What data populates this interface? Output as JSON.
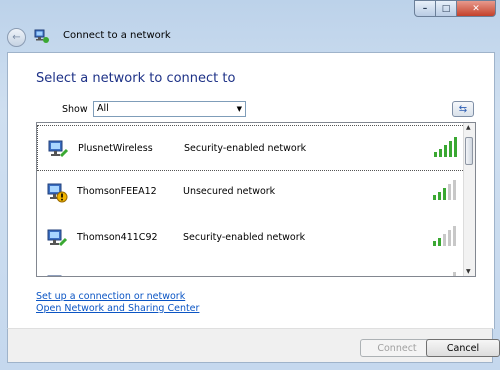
{
  "window": {
    "header_title": "Connect to a network"
  },
  "main": {
    "title": "Select a network to connect to",
    "show_label": "Show",
    "show_value": "All",
    "networks": [
      {
        "name": "PlusnetWireless",
        "security": "Security-enabled network",
        "signal_bars": 5,
        "secured": true
      },
      {
        "name": "ThomsonFEEA12",
        "security": "Unsecured network",
        "signal_bars": 3,
        "secured": false
      },
      {
        "name": "Thomson411C92",
        "security": "Security-enabled network",
        "signal_bars": 2,
        "secured": true
      }
    ]
  },
  "links": {
    "setup": "Set up a connection or network",
    "sharing": "Open Network and Sharing Center"
  },
  "buttons": {
    "connect": "Connect",
    "cancel": "Cancel"
  },
  "colors": {
    "title_blue": "#1e3287",
    "link_blue": "#0b55c4",
    "signal_green": "#3aa832"
  }
}
